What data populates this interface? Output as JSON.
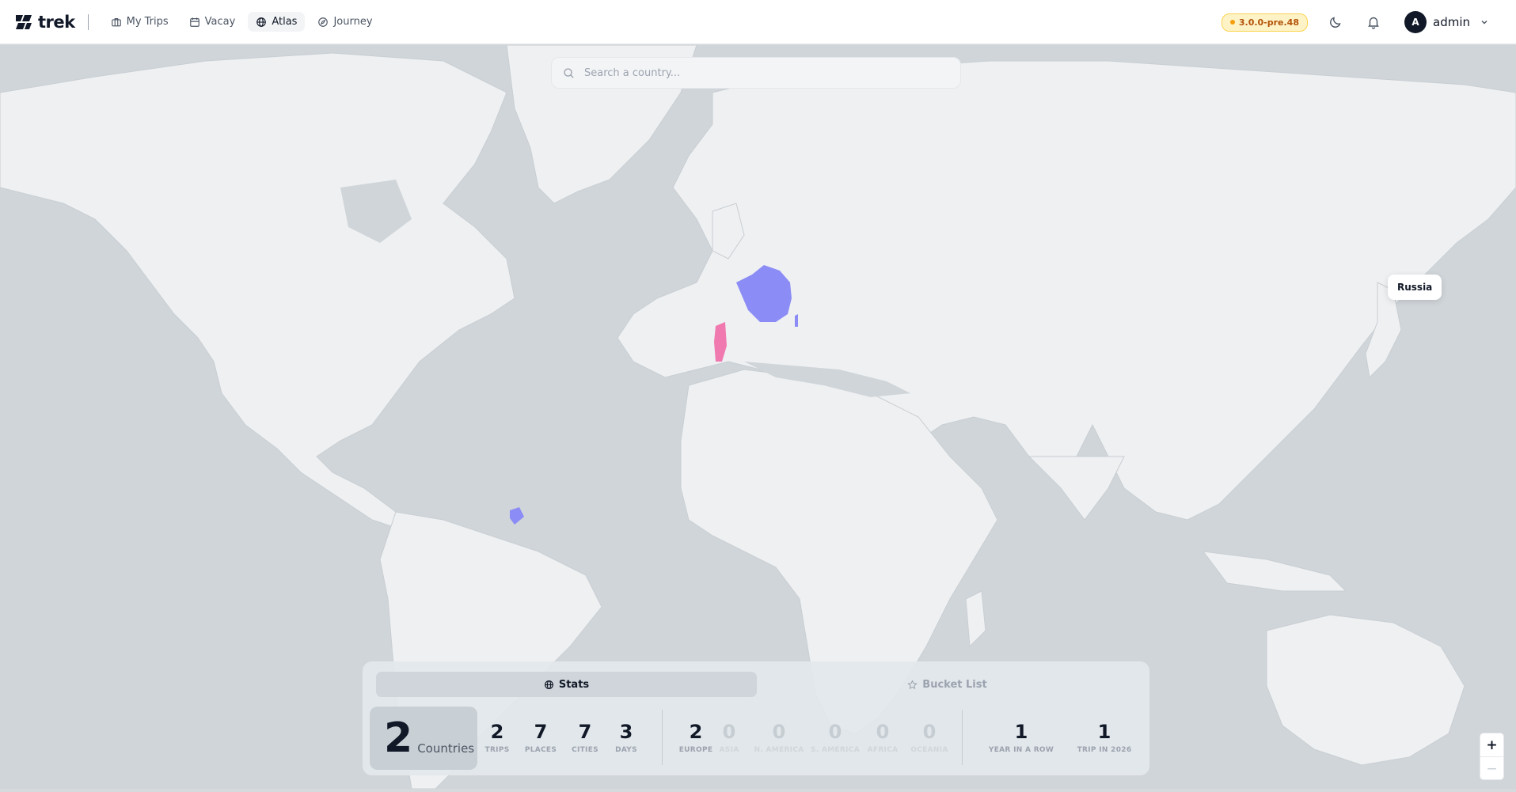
{
  "brand": {
    "name": "trek"
  },
  "nav": [
    {
      "label": "My Trips",
      "icon": "briefcase-icon"
    },
    {
      "label": "Vacay",
      "icon": "calendar-icon"
    },
    {
      "label": "Atlas",
      "icon": "globe-icon",
      "active": true
    },
    {
      "label": "Journey",
      "icon": "compass-icon"
    }
  ],
  "header": {
    "version": "3.0.0-pre.48",
    "user": {
      "initial": "A",
      "name": "admin"
    }
  },
  "search": {
    "placeholder": "Search a country..."
  },
  "map": {
    "tooltip": "Russia",
    "colors": {
      "visited": "#8b8cf5",
      "highlight": "#f07ab0",
      "land": "#f1f3f5",
      "water": "#d0d5d9"
    }
  },
  "panel": {
    "tabs": [
      {
        "label": "Stats",
        "active": true
      },
      {
        "label": "Bucket List",
        "active": false
      }
    ],
    "countries": {
      "count": "2",
      "label": "Countries"
    },
    "stats": [
      {
        "value": "2",
        "label": "TRIPS"
      },
      {
        "value": "7",
        "label": "PLACES"
      },
      {
        "value": "7",
        "label": "CITIES"
      },
      {
        "value": "3",
        "label": "DAYS"
      }
    ],
    "continents": [
      {
        "value": "2",
        "label": "EUROPE"
      },
      {
        "value": "0",
        "label": "ASIA"
      },
      {
        "value": "0",
        "label": "N. AMERICA"
      },
      {
        "value": "0",
        "label": "S. AMERICA"
      },
      {
        "value": "0",
        "label": "AFRICA"
      },
      {
        "value": "0",
        "label": "OCEANIA"
      }
    ],
    "streaks": [
      {
        "value": "1",
        "label": "YEAR IN A ROW"
      },
      {
        "value": "1",
        "label": "TRIP IN 2026"
      }
    ]
  },
  "zoom": {
    "in": "+",
    "out": "−"
  }
}
